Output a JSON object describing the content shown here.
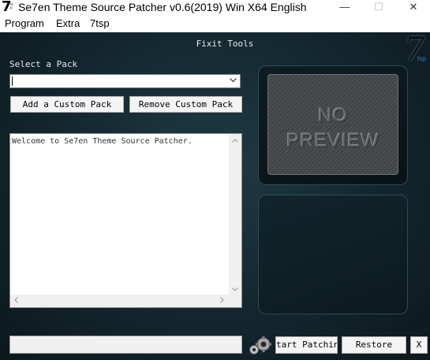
{
  "window": {
    "icon_seven": "7",
    "icon_tsp": "tsp",
    "title": "Se7en Theme Source Patcher v0.6(2019) Win X64 English",
    "minimize": "—",
    "maximize": "☐",
    "close": "✕"
  },
  "menu": {
    "program": "Program",
    "extra": "Extra",
    "tsp": "7tsp"
  },
  "main": {
    "header": "Fixit Tools",
    "logo_number": "7",
    "logo_tsp": "tsp",
    "select_label": "Select a Pack",
    "pack_value": "",
    "add_button": "Add a Custom Pack",
    "remove_button": "Remove Custom Pack",
    "log_text": "Welcome to Se7en Theme Source Patcher.",
    "preview_line1": "NO",
    "preview_line2": "PREVIEW",
    "start_button": "tart Patchin",
    "restore_button": "Restore",
    "exit_button": "X"
  }
}
